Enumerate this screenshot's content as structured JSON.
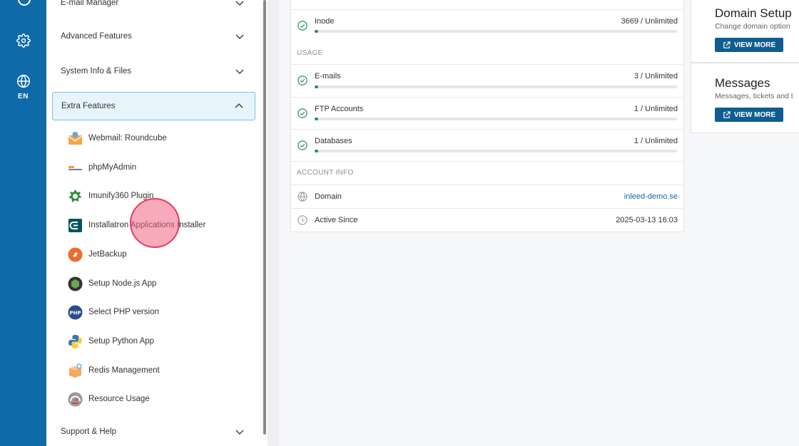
{
  "rail": {
    "settings_icon": "gear-icon",
    "language_icon": "globe-icon",
    "language_label": "EN"
  },
  "sidebar": {
    "sections": [
      {
        "label": "E-mail Manager",
        "expanded": false
      },
      {
        "label": "Advanced Features",
        "expanded": false
      },
      {
        "label": "System Info & Files",
        "expanded": false
      },
      {
        "label": "Extra Features",
        "expanded": true
      },
      {
        "label": "Support & Help",
        "expanded": false
      }
    ],
    "extra_items": [
      {
        "label": "Webmail: Roundcube",
        "icon": "roundcube-icon"
      },
      {
        "label": "phpMyAdmin",
        "icon": "phpmyadmin-icon"
      },
      {
        "label": "Imunify360 Plugin",
        "icon": "imunify-icon"
      },
      {
        "label": "Installatron Applications Installer",
        "icon": "installatron-icon"
      },
      {
        "label": "JetBackup",
        "icon": "jetbackup-icon"
      },
      {
        "label": "Setup Node.js App",
        "icon": "nodejs-icon"
      },
      {
        "label": "Select PHP version",
        "icon": "php-icon"
      },
      {
        "label": "Setup Python App",
        "icon": "python-icon"
      },
      {
        "label": "Redis Management",
        "icon": "redis-icon"
      },
      {
        "label": "Resource Usage",
        "icon": "resource-usage-icon"
      }
    ]
  },
  "stats": {
    "inode": {
      "label": "Inode",
      "value": "3669 / Unlimited",
      "fraction": 0.01
    },
    "usage_heading": "USAGE",
    "usage": [
      {
        "label": "E-mails",
        "value": "3 / Unlimited",
        "fraction": 0.01
      },
      {
        "label": "FTP Accounts",
        "value": "1 / Unlimited",
        "fraction": 0.01
      },
      {
        "label": "Databases",
        "value": "1 / Unlimited",
        "fraction": 0.01
      }
    ],
    "account_heading": "ACCOUNT INFO",
    "account": [
      {
        "label": "Domain",
        "value": "inleed-demo.se",
        "icon": "globe-icon"
      },
      {
        "label": "Active Since",
        "value": "2025-03-13 16:03",
        "icon": "clock-icon"
      }
    ]
  },
  "cards": [
    {
      "title": "Domain Setup",
      "desc": "Change domain option",
      "button": "VIEW MORE"
    },
    {
      "title": "Messages",
      "desc": "Messages, tickets and t",
      "button": "VIEW MORE"
    }
  ],
  "colors": {
    "rail": "#0e6aa8",
    "accent": "#0f5d8f",
    "progress": "#2f8f5b",
    "check": "#2f8f5b",
    "cursor": "#e33c63"
  }
}
